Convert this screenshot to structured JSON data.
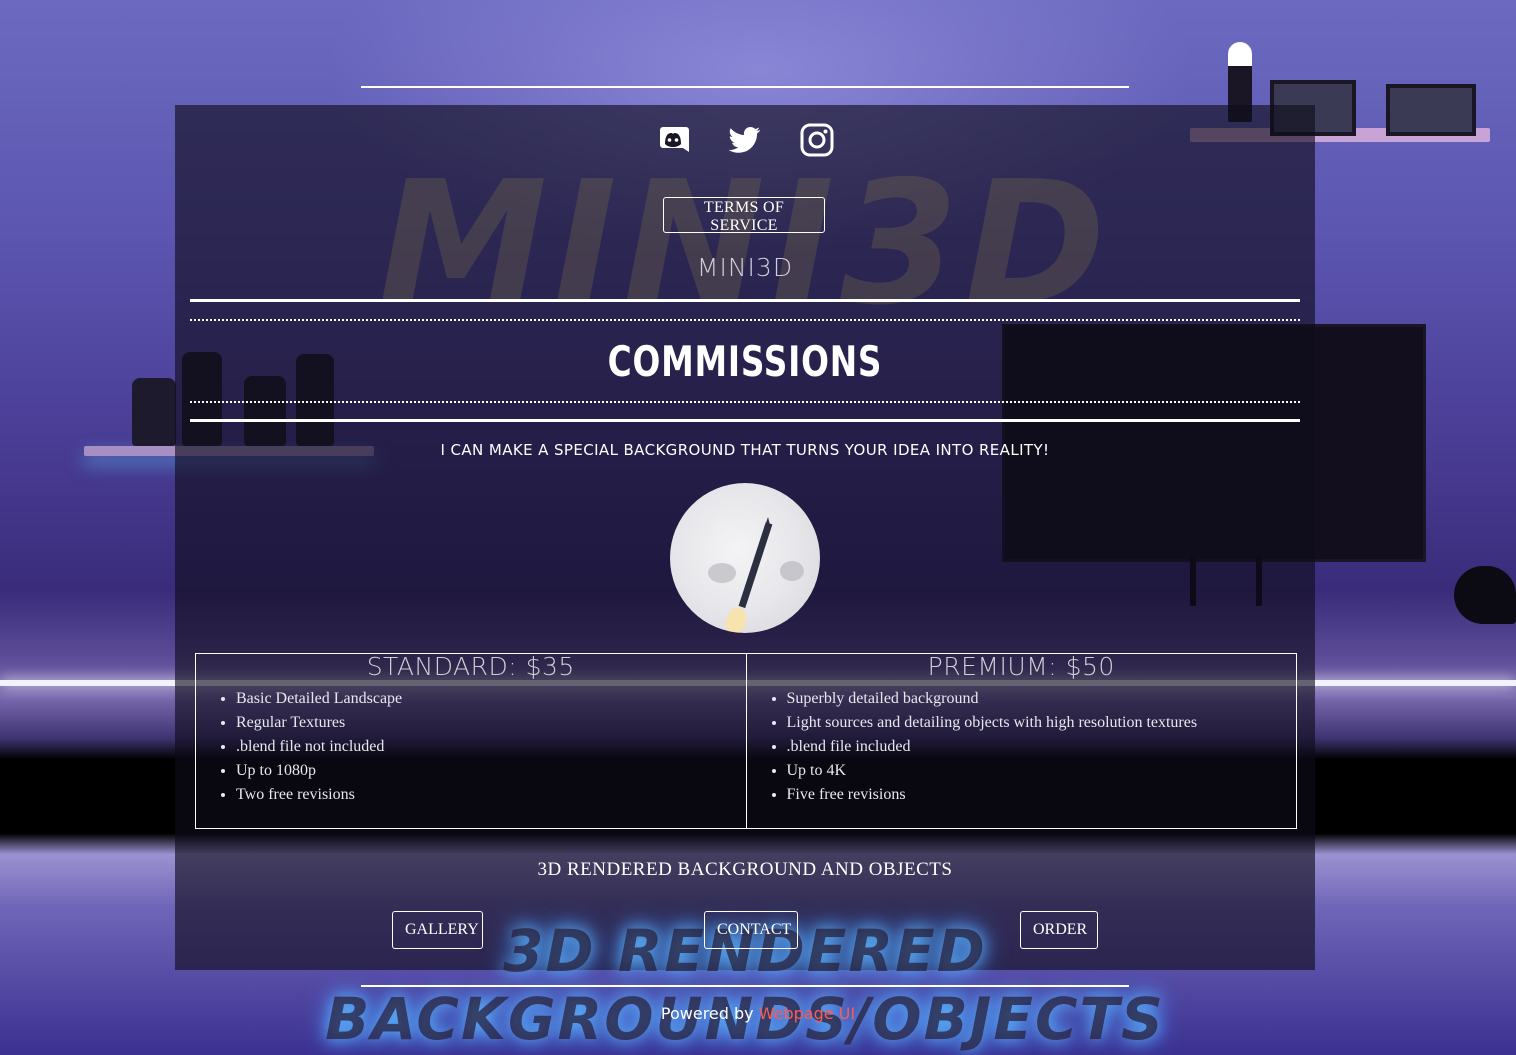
{
  "social": [
    {
      "name": "discord"
    },
    {
      "name": "twitter"
    },
    {
      "name": "instagram"
    }
  ],
  "watermark": {
    "top": "MINI3D",
    "bottom": "3D RENDERED BACKGROUNDS/OBJECTS"
  },
  "tos_label": "TERMS OF SERVICE",
  "brand": "MINI3D",
  "heading": "COMMISSIONS",
  "tagline": "I CAN MAKE A SPECIAL BACKGROUND THAT TURNS YOUR IDEA INTO REALITY!",
  "avatar_icon": "rocket-launch-icon",
  "tiers": [
    {
      "title": "STANDARD: $35",
      "features": [
        "Basic Detailed Landscape",
        "Regular Textures",
        ".blend file not included",
        "Up to 1080p",
        "Two free revisions"
      ]
    },
    {
      "title": "PREMIUM: $50",
      "features": [
        "Superbly detailed background",
        "Light sources and detailing objects with high resolution textures",
        ".blend file included",
        "Up to 4K",
        "Five free revisions"
      ]
    }
  ],
  "subtitle": "3D RENDERED BACKGROUND AND OBJECTS",
  "nav": {
    "gallery": "GALLERY",
    "contact": "CONTACT",
    "order": "ORDER"
  },
  "footer": {
    "prefix": "Powered by",
    "link": "Webpage UI"
  },
  "colors": {
    "panel": "#0e0c1a",
    "link": "#ff5a52",
    "glow": "#5fb8ff"
  }
}
